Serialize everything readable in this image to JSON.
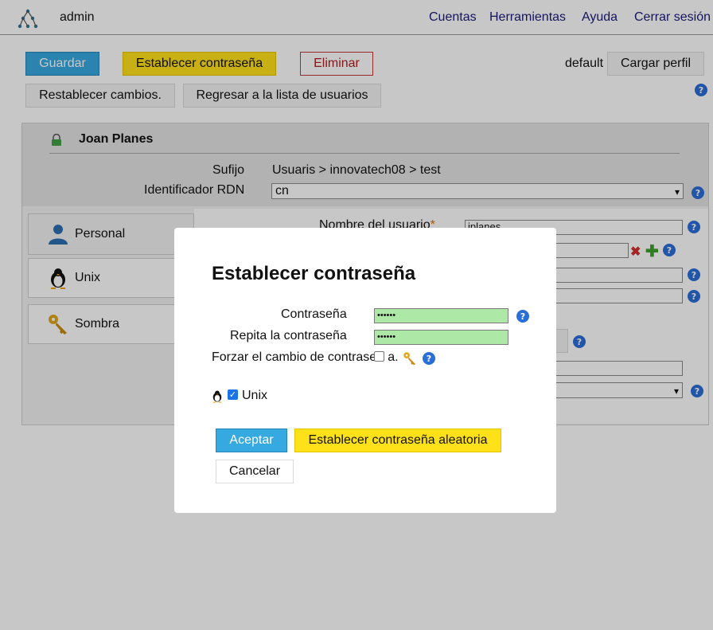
{
  "topbar": {
    "user": "admin",
    "nav": [
      "Cuentas",
      "Herramientas",
      "Ayuda",
      "Cerrar sesión"
    ]
  },
  "toolbar": {
    "save": "Guardar",
    "set_password": "Establecer contraseña",
    "delete": "Eliminar",
    "profile_name": "default",
    "load_profile": "Cargar perfil",
    "reset_changes": "Restablecer cambios.",
    "back_to_list": "Regresar a la lista de usuarios"
  },
  "header": {
    "name": "Joan Planes",
    "suffix_label": "Sufijo",
    "suffix_value": "Usuaris > innovatech08 > test",
    "rdn_label": "Identificador RDN",
    "rdn_value": "cn"
  },
  "tabs": [
    {
      "label": "Personal",
      "icon": "person-icon"
    },
    {
      "label": "Unix",
      "icon": "penguin-icon"
    },
    {
      "label": "Sombra",
      "icon": "key-icon"
    }
  ],
  "form": {
    "username_label": "Nombre del usuario",
    "required_mark": "*",
    "username_value": "jplanes"
  },
  "modal": {
    "title": "Establecer contraseña",
    "password_label": "Contraseña",
    "password_value": "••••••",
    "repeat_label": "Repita la contraseña",
    "repeat_value": "••••••",
    "force_label_part1": "Forzar el cambio de contrase",
    "force_label_part2": "a.",
    "force_checked": false,
    "unix_label": "Unix",
    "unix_checked": true,
    "accept": "Aceptar",
    "random_password": "Establecer contraseña aleatoria",
    "cancel": "Cancelar"
  },
  "colors": {
    "accent_blue": "#36a9e1",
    "accent_yellow": "#ffe11a",
    "danger": "#c83535",
    "password_field": "#aee8a6",
    "help_icon": "#2a6ed8",
    "link": "#1b1b7a"
  }
}
